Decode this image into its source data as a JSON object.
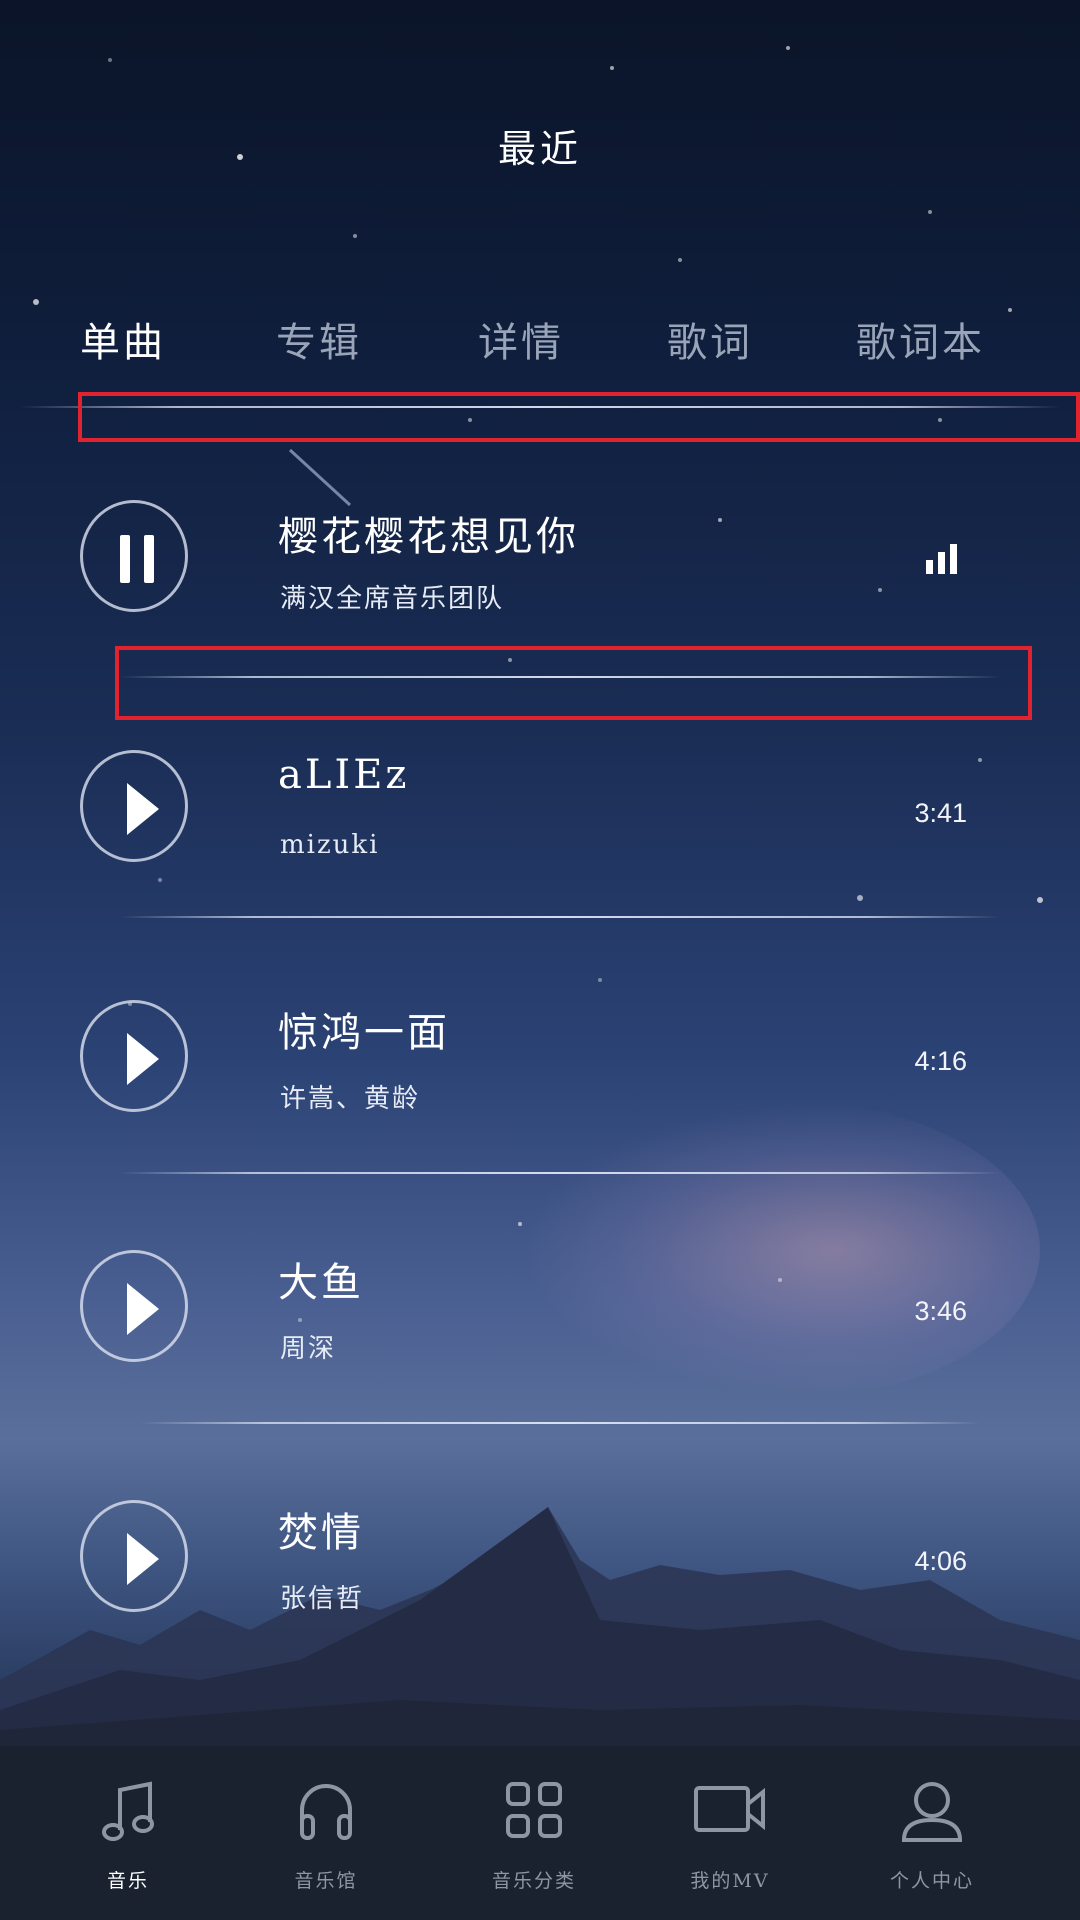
{
  "header": {
    "title": "最近"
  },
  "tabs": [
    {
      "label": "单曲",
      "active": true
    },
    {
      "label": "专辑",
      "active": false
    },
    {
      "label": "详情",
      "active": false
    },
    {
      "label": "歌词",
      "active": false
    },
    {
      "label": "歌词本",
      "active": false
    }
  ],
  "songs": [
    {
      "title": "樱花樱花想见你",
      "artist": "满汉全席音乐团队",
      "duration": "",
      "state": "playing",
      "icon": "pause-icon",
      "indicator": "equalizer-icon"
    },
    {
      "title": "aLIEz",
      "artist": "mizuki",
      "duration": "3:41",
      "state": "paused",
      "icon": "play-icon"
    },
    {
      "title": "惊鸿一面",
      "artist": "许嵩、黄龄",
      "duration": "4:16",
      "state": "paused",
      "icon": "play-icon"
    },
    {
      "title": "大鱼",
      "artist": "周深",
      "duration": "3:46",
      "state": "paused",
      "icon": "play-icon"
    },
    {
      "title": "焚情",
      "artist": "张信哲",
      "duration": "4:06",
      "state": "paused",
      "icon": "play-icon"
    }
  ],
  "bottom_nav": [
    {
      "label": "音乐",
      "icon": "music-note-icon",
      "active": true
    },
    {
      "label": "音乐馆",
      "icon": "headphones-icon",
      "active": false
    },
    {
      "label": "音乐分类",
      "icon": "grid-icon",
      "active": false
    },
    {
      "label": "我的MV",
      "icon": "video-camera-icon",
      "active": false
    },
    {
      "label": "个人中心",
      "icon": "user-icon",
      "active": false
    }
  ],
  "colors": {
    "highlight_box": "#e0232e",
    "tab_active": "#ffffff",
    "tab_inactive": "#9aa4b8",
    "nav_background": "#1a2230"
  }
}
